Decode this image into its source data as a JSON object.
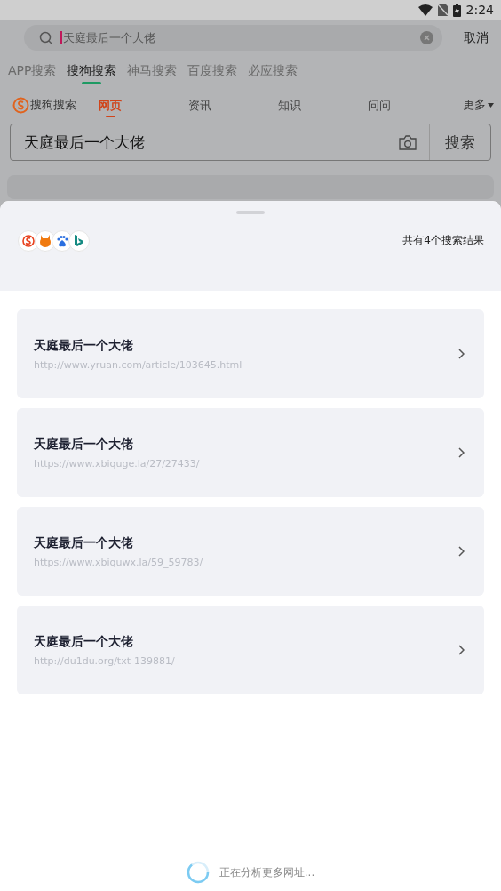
{
  "status_bar": {
    "time": "2:24"
  },
  "search": {
    "value": "天庭最后一个大佬",
    "cancel": "取消"
  },
  "engine_tabs": [
    {
      "label": "APP搜索",
      "selected": false
    },
    {
      "label": "搜狗搜索",
      "selected": true
    },
    {
      "label": "神马搜索",
      "selected": false
    },
    {
      "label": "百度搜索",
      "selected": false
    },
    {
      "label": "必应搜索",
      "selected": false
    }
  ],
  "sogou": {
    "brand": "搜狗搜索",
    "tabs": [
      {
        "label": "网页",
        "selected": true
      },
      {
        "label": "资讯",
        "selected": false
      },
      {
        "label": "知识",
        "selected": false
      },
      {
        "label": "问问",
        "selected": false
      }
    ],
    "more": "更多",
    "query": "天庭最后一个大佬",
    "search_button": "搜索"
  },
  "sheet": {
    "count": "共有4个搜索结果",
    "results": [
      {
        "title": "天庭最后一个大佬",
        "url": "http://www.yruan.com/article/103645.html"
      },
      {
        "title": "天庭最后一个大佬",
        "url": "https://www.xbiquge.la/27/27433/"
      },
      {
        "title": "天庭最后一个大佬",
        "url": "https://www.xbiquwx.la/59_59783/"
      },
      {
        "title": "天庭最后一个大佬",
        "url": "http://du1du.org/txt-139881/"
      }
    ],
    "loading": "正在分析更多网址..."
  }
}
